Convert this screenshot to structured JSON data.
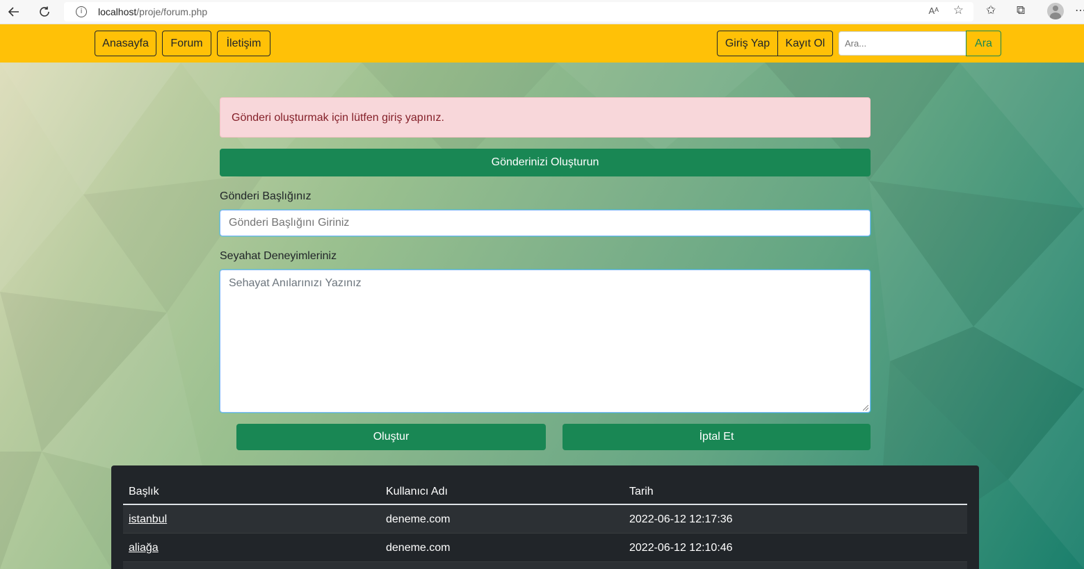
{
  "browser": {
    "url_host": "localhost",
    "url_path": "/proje/forum.php",
    "read_aloud": "Aᴬ"
  },
  "navbar": {
    "links": [
      "Anasayfa",
      "Forum",
      "İletişim"
    ],
    "login": "Giriş Yap",
    "register": "Kayıt Ol",
    "search_placeholder": "Ara...",
    "search_button": "Ara",
    "color": "#ffc107"
  },
  "alert": {
    "message": "Gönderi oluşturmak için lütfen giriş yapınız."
  },
  "form": {
    "header": "Gönderinizi Oluşturun",
    "title_label": "Gönderi Başlığınız",
    "title_placeholder": "Gönderi Başlığını Giriniz",
    "body_label": "Seyahat Deneyimleriniz",
    "body_placeholder": "Sehayat Anılarınızı Yazınız",
    "submit": "Oluştur",
    "cancel": "İptal Et",
    "accent": "#198754"
  },
  "table": {
    "headers": [
      "Başlık",
      "Kullanıcı Adı",
      "Tarih"
    ],
    "rows": [
      {
        "title": "istanbul",
        "user": "deneme.com",
        "date": "2022-06-12 12:17:36"
      },
      {
        "title": "aliağa",
        "user": "deneme.com",
        "date": "2022-06-12 12:10:46"
      }
    ]
  }
}
